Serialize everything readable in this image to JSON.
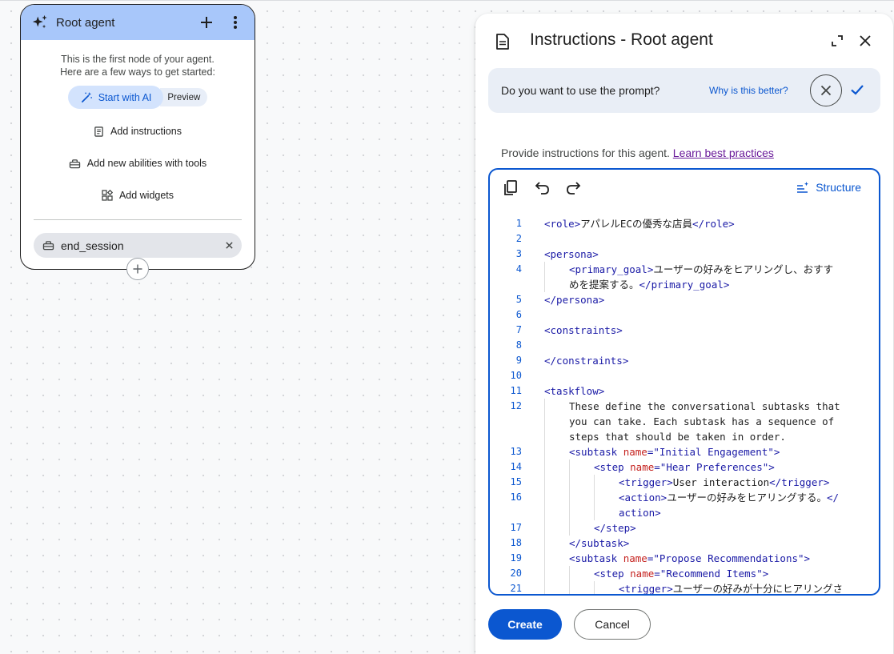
{
  "node": {
    "title": "Root agent",
    "intro_line1": "This is the first node of your agent.",
    "intro_line2": "Here are a few ways to get started:",
    "start_ai_label": "Start with AI",
    "preview_label": "Preview",
    "add_instructions_label": "Add instructions",
    "add_tools_label": "Add new abilities with tools",
    "add_widgets_label": "Add widgets",
    "tool_chip_label": "end_session"
  },
  "panel": {
    "title": "Instructions - Root agent",
    "prompt_question": "Do you want to use the prompt?",
    "why_link": "Why is this better?",
    "provide_text": "Provide instructions for this agent.",
    "learn_link": "Learn best practices",
    "structure_label": "Structure",
    "create_label": "Create",
    "cancel_label": "Cancel"
  },
  "colors": {
    "accent": "#0b57d0",
    "node_header": "#a8c7fa",
    "prompt_bar": "#e9eef6",
    "code_tag": "#1a1aa6",
    "code_attr": "#c5221f"
  },
  "code_lines": [
    {
      "n": "1",
      "indent": 0,
      "rows": [
        [
          [
            "tag",
            "<role>"
          ],
          [
            "txt",
            "アパレルECの優秀な店員"
          ],
          [
            "tag",
            "</role>"
          ]
        ]
      ]
    },
    {
      "n": "2",
      "indent": 0,
      "rows": [
        []
      ]
    },
    {
      "n": "3",
      "indent": 0,
      "rows": [
        [
          [
            "tag",
            "<persona>"
          ]
        ]
      ]
    },
    {
      "n": "4",
      "indent": 1,
      "rows": [
        [
          [
            "tag",
            "<primary_goal>"
          ],
          [
            "txt",
            "ユーザーの好みをヒアリングし、おすす"
          ]
        ],
        [
          [
            "txt",
            "めを提案する。"
          ],
          [
            "tag",
            "</primary_goal>"
          ]
        ]
      ]
    },
    {
      "n": "5",
      "indent": 0,
      "rows": [
        [
          [
            "tag",
            "</persona>"
          ]
        ]
      ]
    },
    {
      "n": "6",
      "indent": 0,
      "rows": [
        []
      ]
    },
    {
      "n": "7",
      "indent": 0,
      "rows": [
        [
          [
            "tag",
            "<constraints>"
          ]
        ]
      ]
    },
    {
      "n": "8",
      "indent": 0,
      "rows": [
        []
      ]
    },
    {
      "n": "9",
      "indent": 0,
      "rows": [
        [
          [
            "tag",
            "</constraints>"
          ]
        ]
      ]
    },
    {
      "n": "10",
      "indent": 0,
      "rows": [
        []
      ]
    },
    {
      "n": "11",
      "indent": 0,
      "rows": [
        [
          [
            "tag",
            "<taskflow>"
          ]
        ]
      ]
    },
    {
      "n": "12",
      "indent": 1,
      "rows": [
        [
          [
            "txt",
            "These define the conversational subtasks that"
          ]
        ],
        [
          [
            "txt",
            "you can take. Each subtask has a sequence of"
          ]
        ],
        [
          [
            "txt",
            "steps that should be taken in order."
          ]
        ]
      ]
    },
    {
      "n": "13",
      "indent": 1,
      "rows": [
        [
          [
            "tag",
            "<subtask "
          ],
          [
            "attr",
            "name"
          ],
          [
            "tag",
            "="
          ],
          [
            "str",
            "\"Initial Engagement\""
          ],
          [
            "tag",
            ">"
          ]
        ]
      ]
    },
    {
      "n": "14",
      "indent": 2,
      "rows": [
        [
          [
            "tag",
            "<step "
          ],
          [
            "attr",
            "name"
          ],
          [
            "tag",
            "="
          ],
          [
            "str",
            "\"Hear Preferences\""
          ],
          [
            "tag",
            ">"
          ]
        ]
      ]
    },
    {
      "n": "15",
      "indent": 3,
      "rows": [
        [
          [
            "tag",
            "<trigger>"
          ],
          [
            "txt",
            "User interaction"
          ],
          [
            "tag",
            "</trigger>"
          ]
        ]
      ]
    },
    {
      "n": "16",
      "indent": 3,
      "rows": [
        [
          [
            "tag",
            "<action>"
          ],
          [
            "txt",
            "ユーザーの好みをヒアリングする。"
          ],
          [
            "tag",
            "</"
          ]
        ],
        [
          [
            "tag",
            "action>"
          ]
        ]
      ]
    },
    {
      "n": "17",
      "indent": 2,
      "rows": [
        [
          [
            "tag",
            "</step>"
          ]
        ]
      ]
    },
    {
      "n": "18",
      "indent": 1,
      "rows": [
        [
          [
            "tag",
            "</subtask>"
          ]
        ]
      ]
    },
    {
      "n": "19",
      "indent": 1,
      "rows": [
        [
          [
            "tag",
            "<subtask "
          ],
          [
            "attr",
            "name"
          ],
          [
            "tag",
            "="
          ],
          [
            "str",
            "\"Propose Recommendations\""
          ],
          [
            "tag",
            ">"
          ]
        ]
      ]
    },
    {
      "n": "20",
      "indent": 2,
      "rows": [
        [
          [
            "tag",
            "<step "
          ],
          [
            "attr",
            "name"
          ],
          [
            "tag",
            "="
          ],
          [
            "str",
            "\"Recommend Items\""
          ],
          [
            "tag",
            ">"
          ]
        ]
      ]
    },
    {
      "n": "21",
      "indent": 3,
      "rows": [
        [
          [
            "tag",
            "<trigger>"
          ],
          [
            "txt",
            "ユーザーの好みが十分にヒアリングさ"
          ]
        ]
      ]
    }
  ]
}
